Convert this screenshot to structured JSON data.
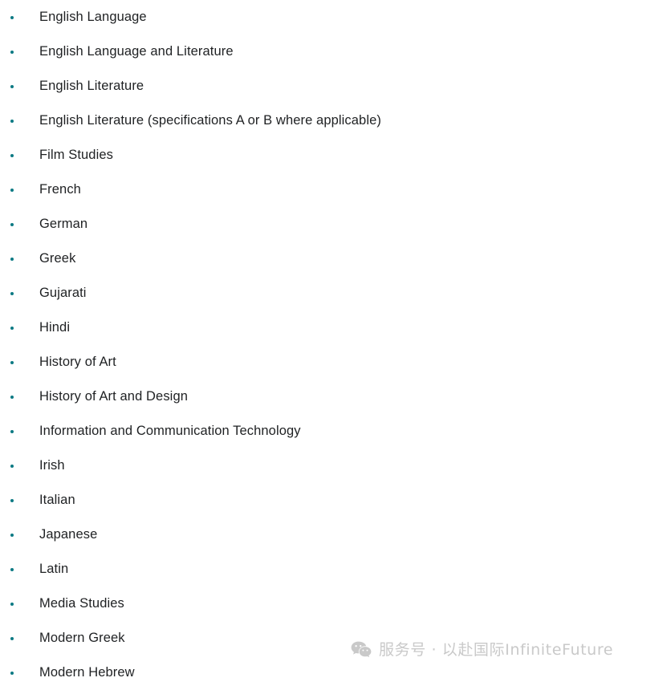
{
  "page": {
    "background_color": "#ffffff",
    "text_color": "#1f2123",
    "bullet_color": "#0d7a84"
  },
  "subject_list": {
    "name": "gcse-subject-list",
    "items": [
      {
        "label": "English Language"
      },
      {
        "label": "English Language and Literature"
      },
      {
        "label": "English Literature"
      },
      {
        "label": "English Literature (specifications A or B where applicable)"
      },
      {
        "label": "Film Studies"
      },
      {
        "label": "French"
      },
      {
        "label": "German"
      },
      {
        "label": "Greek"
      },
      {
        "label": "Gujarati"
      },
      {
        "label": "Hindi"
      },
      {
        "label": "History of Art"
      },
      {
        "label": "History of Art and Design"
      },
      {
        "label": "Information and Communication Technology"
      },
      {
        "label": "Irish"
      },
      {
        "label": "Italian"
      },
      {
        "label": "Japanese"
      },
      {
        "label": "Latin"
      },
      {
        "label": "Media Studies"
      },
      {
        "label": "Modern Greek"
      },
      {
        "label": "Modern Hebrew"
      }
    ]
  },
  "watermark": {
    "icon": "wechat-icon",
    "text": "服务号 · 以赴国际InfiniteFuture",
    "color": "#c9c9c9"
  }
}
